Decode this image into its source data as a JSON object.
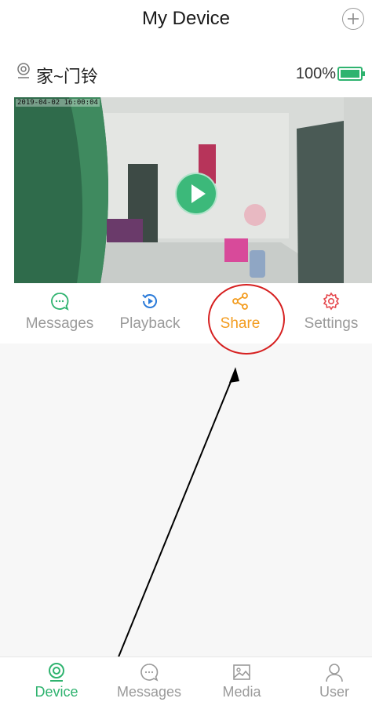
{
  "header": {
    "title": "My Device"
  },
  "device": {
    "name": "家~门铃",
    "battery": "100%",
    "timestamp": "2019-04-02 16:00:04"
  },
  "actions": [
    {
      "label": "Messages",
      "icon": "chat-bubble-icon",
      "color": "#2fb36f"
    },
    {
      "label": "Playback",
      "icon": "playback-icon",
      "color": "#2b7bd9"
    },
    {
      "label": "Share",
      "icon": "share-icon",
      "color": "#f39c1f"
    },
    {
      "label": "Settings",
      "icon": "gear-icon",
      "color": "#e5484d"
    }
  ],
  "tabs": [
    {
      "label": "Device",
      "icon": "camera-icon",
      "active": true
    },
    {
      "label": "Messages",
      "icon": "chat-bubble-icon",
      "active": false
    },
    {
      "label": "Media",
      "icon": "image-icon",
      "active": false
    },
    {
      "label": "User",
      "icon": "user-icon",
      "active": false
    }
  ],
  "colors": {
    "accent": "#2fb36f",
    "annotation": "#d62020"
  }
}
